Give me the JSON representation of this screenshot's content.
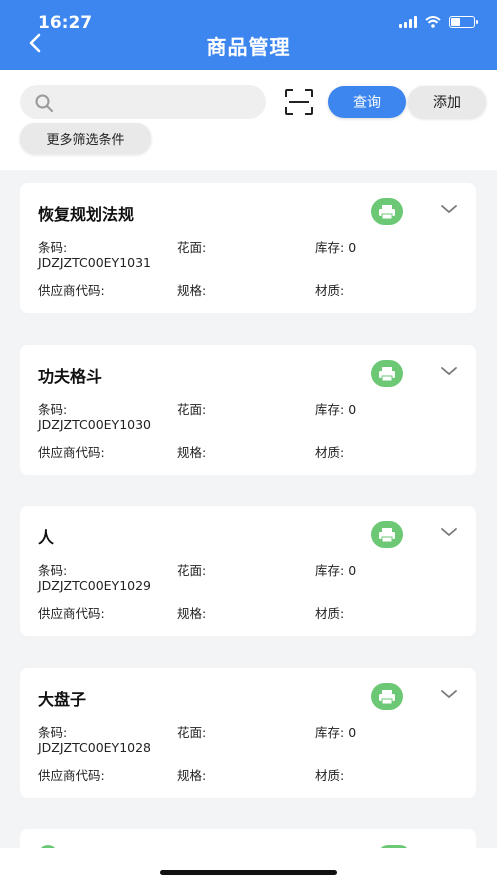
{
  "status_bar": {
    "time": "16:27"
  },
  "header": {
    "title": "商品管理"
  },
  "search": {
    "placeholder": "",
    "query_label": "查询",
    "add_label": "添加",
    "more_filters_label": "更多筛选条件"
  },
  "labels": {
    "barcode": "条码:",
    "pattern": "花面:",
    "stock": "库存: ",
    "supplier_code": "供应商代码:",
    "spec": "规格:",
    "material": "材质:"
  },
  "products": [
    {
      "name": "恢复规划法规",
      "barcode": "JDZJZTC00EY1031",
      "stock": "0"
    },
    {
      "name": "功夫格斗",
      "barcode": "JDZJZTC00EY1030",
      "stock": "0"
    },
    {
      "name": "人",
      "barcode": "JDZJZTC00EY1029",
      "stock": "0"
    },
    {
      "name": "大盘子",
      "barcode": "JDZJZTC00EY1028",
      "stock": "0"
    }
  ],
  "colors": {
    "primary": "#3d86f0",
    "print_green": "#6cc874",
    "background": "#f3f4f6"
  },
  "icons": {
    "back": "chevron-left-icon",
    "search": "search-icon",
    "scan": "scan-icon",
    "print": "printer-icon",
    "expand": "chevron-down-icon"
  }
}
